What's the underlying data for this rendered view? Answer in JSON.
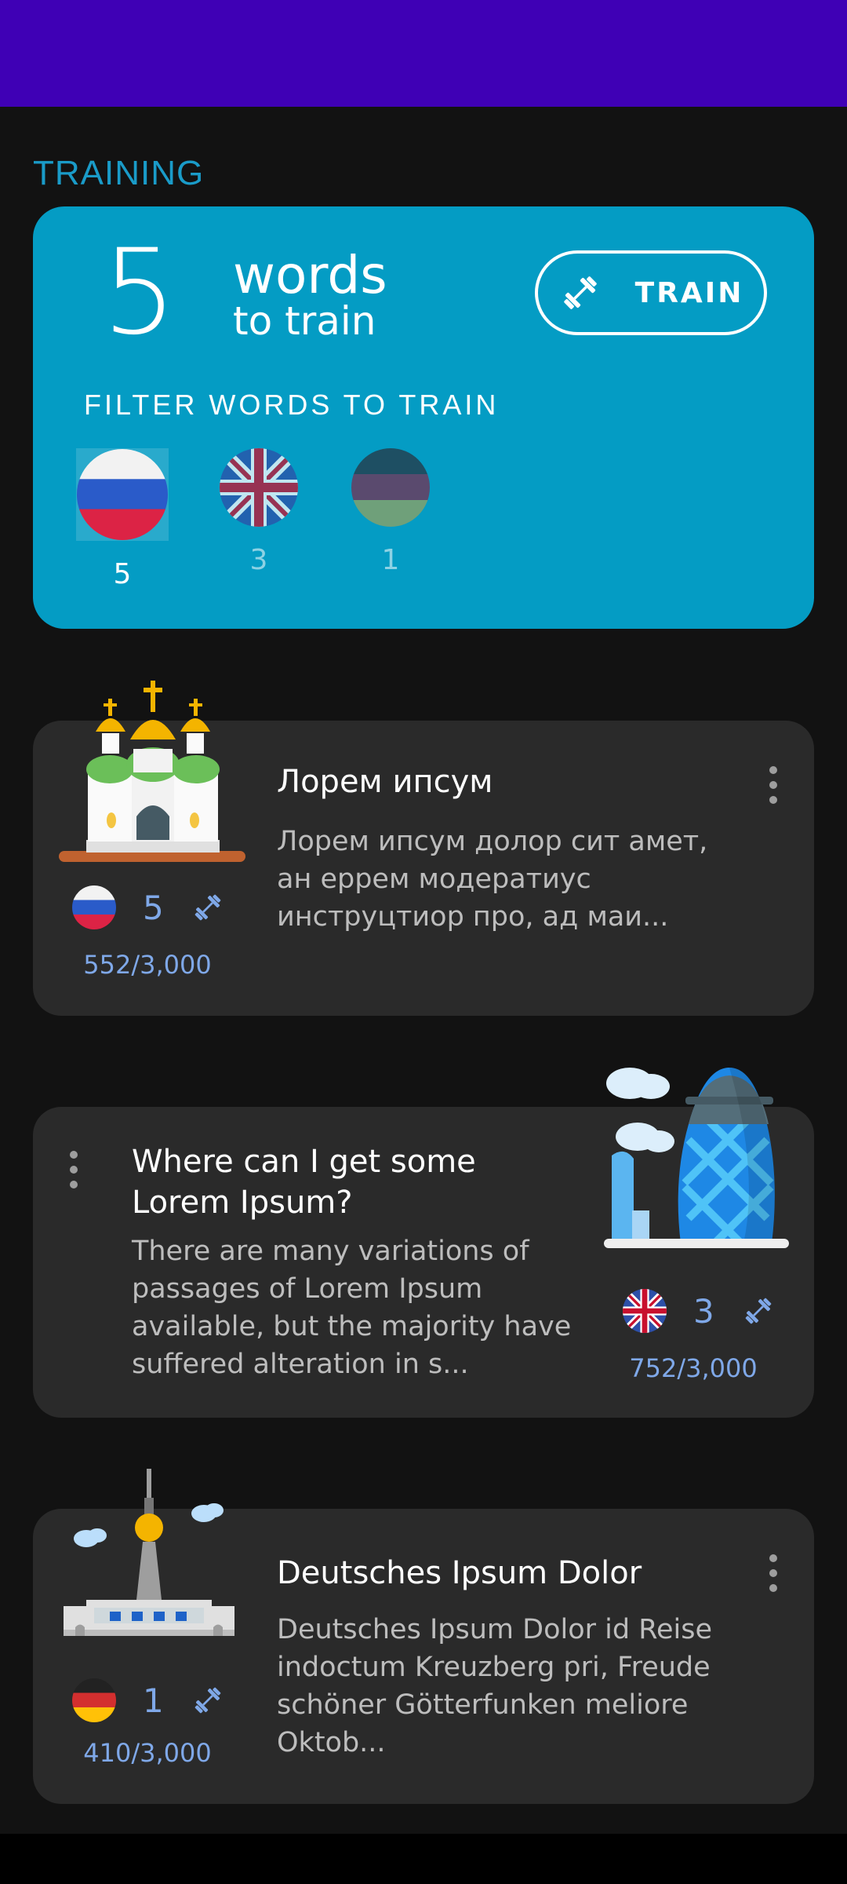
{
  "section_title": "TRAINING",
  "training": {
    "count": "5",
    "words_label": "words",
    "sub_label": "to train",
    "train_button": "TRAIN",
    "filter_label": "FILTER WORDS TO TRAIN",
    "filters": [
      {
        "flag": "russia-flag-icon",
        "count": "5",
        "selected": true
      },
      {
        "flag": "uk-flag-icon",
        "count": "3",
        "selected": false
      },
      {
        "flag": "dark-flag-icon",
        "count": "1",
        "selected": false
      }
    ]
  },
  "texts": [
    {
      "title": "Лорем ипсум",
      "desc": "Лорем ипсум долор сит амет, ан еррем модератиус инструцтиор про, ад маи...",
      "flag": "russia-flag-icon",
      "word_count": "5",
      "progress": "552/3,000",
      "illustration": "orthodox-church-icon"
    },
    {
      "title": "Where can I get some Lorem Ipsum?",
      "desc": "There are many variations of passages of Lorem Ipsum available, but the majority have suffered alteration in s...",
      "flag": "uk-flag-icon",
      "word_count": "3",
      "progress": "752/3,000",
      "illustration": "gherkin-tower-icon"
    },
    {
      "title": "Deutsches Ipsum Dolor",
      "desc": "Deutsches Ipsum Dolor id Reise indoctum Kreuzberg pri, Freude schöner Götterfunken meliore Oktob...",
      "flag": "germany-flag-icon",
      "word_count": "1",
      "progress": "410/3,000",
      "illustration": "tv-tower-icon"
    }
  ],
  "colors": {
    "status_bar": "#3F00B5",
    "accent": "#049CC4",
    "card": "#2A2A2A",
    "meta": "#7FA8E8"
  }
}
